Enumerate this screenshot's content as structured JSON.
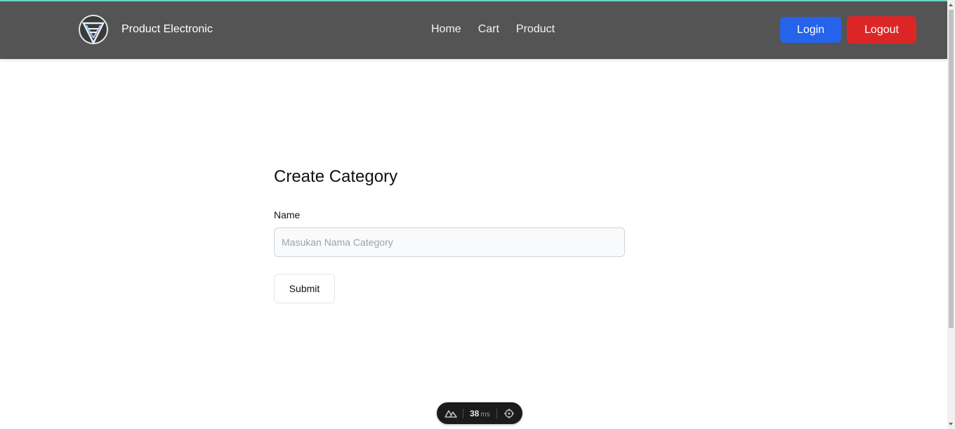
{
  "navbar": {
    "brand": "Product Electronic",
    "links": [
      "Home",
      "Cart",
      "Product"
    ],
    "login_label": "Login",
    "logout_label": "Logout"
  },
  "form": {
    "title": "Create Category",
    "name_label": "Name",
    "name_placeholder": "Masukan Nama Category",
    "name_value": "",
    "submit_label": "Submit"
  },
  "devtools": {
    "time_value": "38",
    "time_unit": "ms"
  },
  "colors": {
    "navbar": "#545454",
    "login": "#2563eb",
    "logout": "#dc2626"
  },
  "icons": {
    "logo": "brand-logo-icon",
    "devtools_logo": "nuxt-icon",
    "devtools_target": "crosshair-icon"
  }
}
